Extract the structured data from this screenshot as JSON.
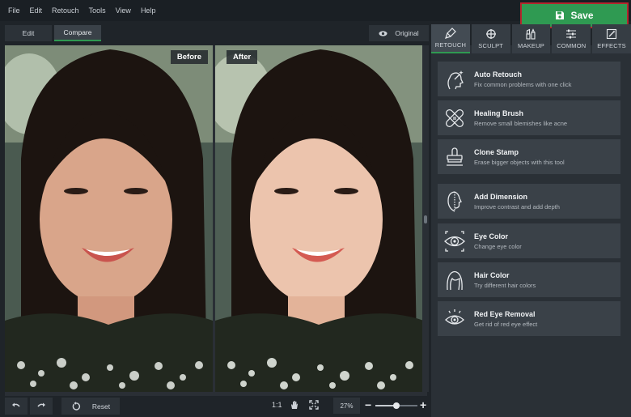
{
  "menu": [
    "File",
    "Edit",
    "Retouch",
    "Tools",
    "View",
    "Help"
  ],
  "save_label": "Save",
  "toolbar": {
    "edit": "Edit",
    "compare": "Compare",
    "original": "Original"
  },
  "canvas": {
    "before_label": "Before",
    "after_label": "After"
  },
  "tabs": [
    {
      "label": "RETOUCH",
      "icon": "brush-icon",
      "active": true
    },
    {
      "label": "SCULPT",
      "icon": "crosshair-icon",
      "active": false
    },
    {
      "label": "MAKEUP",
      "icon": "lipstick-icon",
      "active": false
    },
    {
      "label": "COMMON",
      "icon": "sliders-icon",
      "active": false
    },
    {
      "label": "EFFECTS",
      "icon": "magic-wand-icon",
      "active": false
    }
  ],
  "tools": [
    {
      "title": "Auto Retouch",
      "desc": "Fix common problems with one click",
      "icon": "auto-retouch-icon"
    },
    {
      "title": "Healing Brush",
      "desc": "Remove small blemishes like acne",
      "icon": "bandage-icon"
    },
    {
      "title": "Clone Stamp",
      "desc": "Erase bigger objects with this tool",
      "icon": "stamp-icon"
    },
    {
      "title": "Add Dimension",
      "desc": "Improve contrast and add depth",
      "icon": "face-profile-icon"
    },
    {
      "title": "Eye Color",
      "desc": "Change eye color",
      "icon": "eye-color-icon"
    },
    {
      "title": "Hair Color",
      "desc": "Try different hair colors",
      "icon": "hair-icon"
    },
    {
      "title": "Red Eye Removal",
      "desc": "Get rid of red eye effect",
      "icon": "red-eye-icon"
    }
  ],
  "bottom": {
    "reset": "Reset",
    "ratio": "1:1",
    "zoom": "27%",
    "zoom_level": 0.5
  },
  "colors": {
    "accent": "#2f9a52",
    "save_border": "#b3262d",
    "panel": "#2a3036",
    "tool_bg": "#3a4148"
  }
}
